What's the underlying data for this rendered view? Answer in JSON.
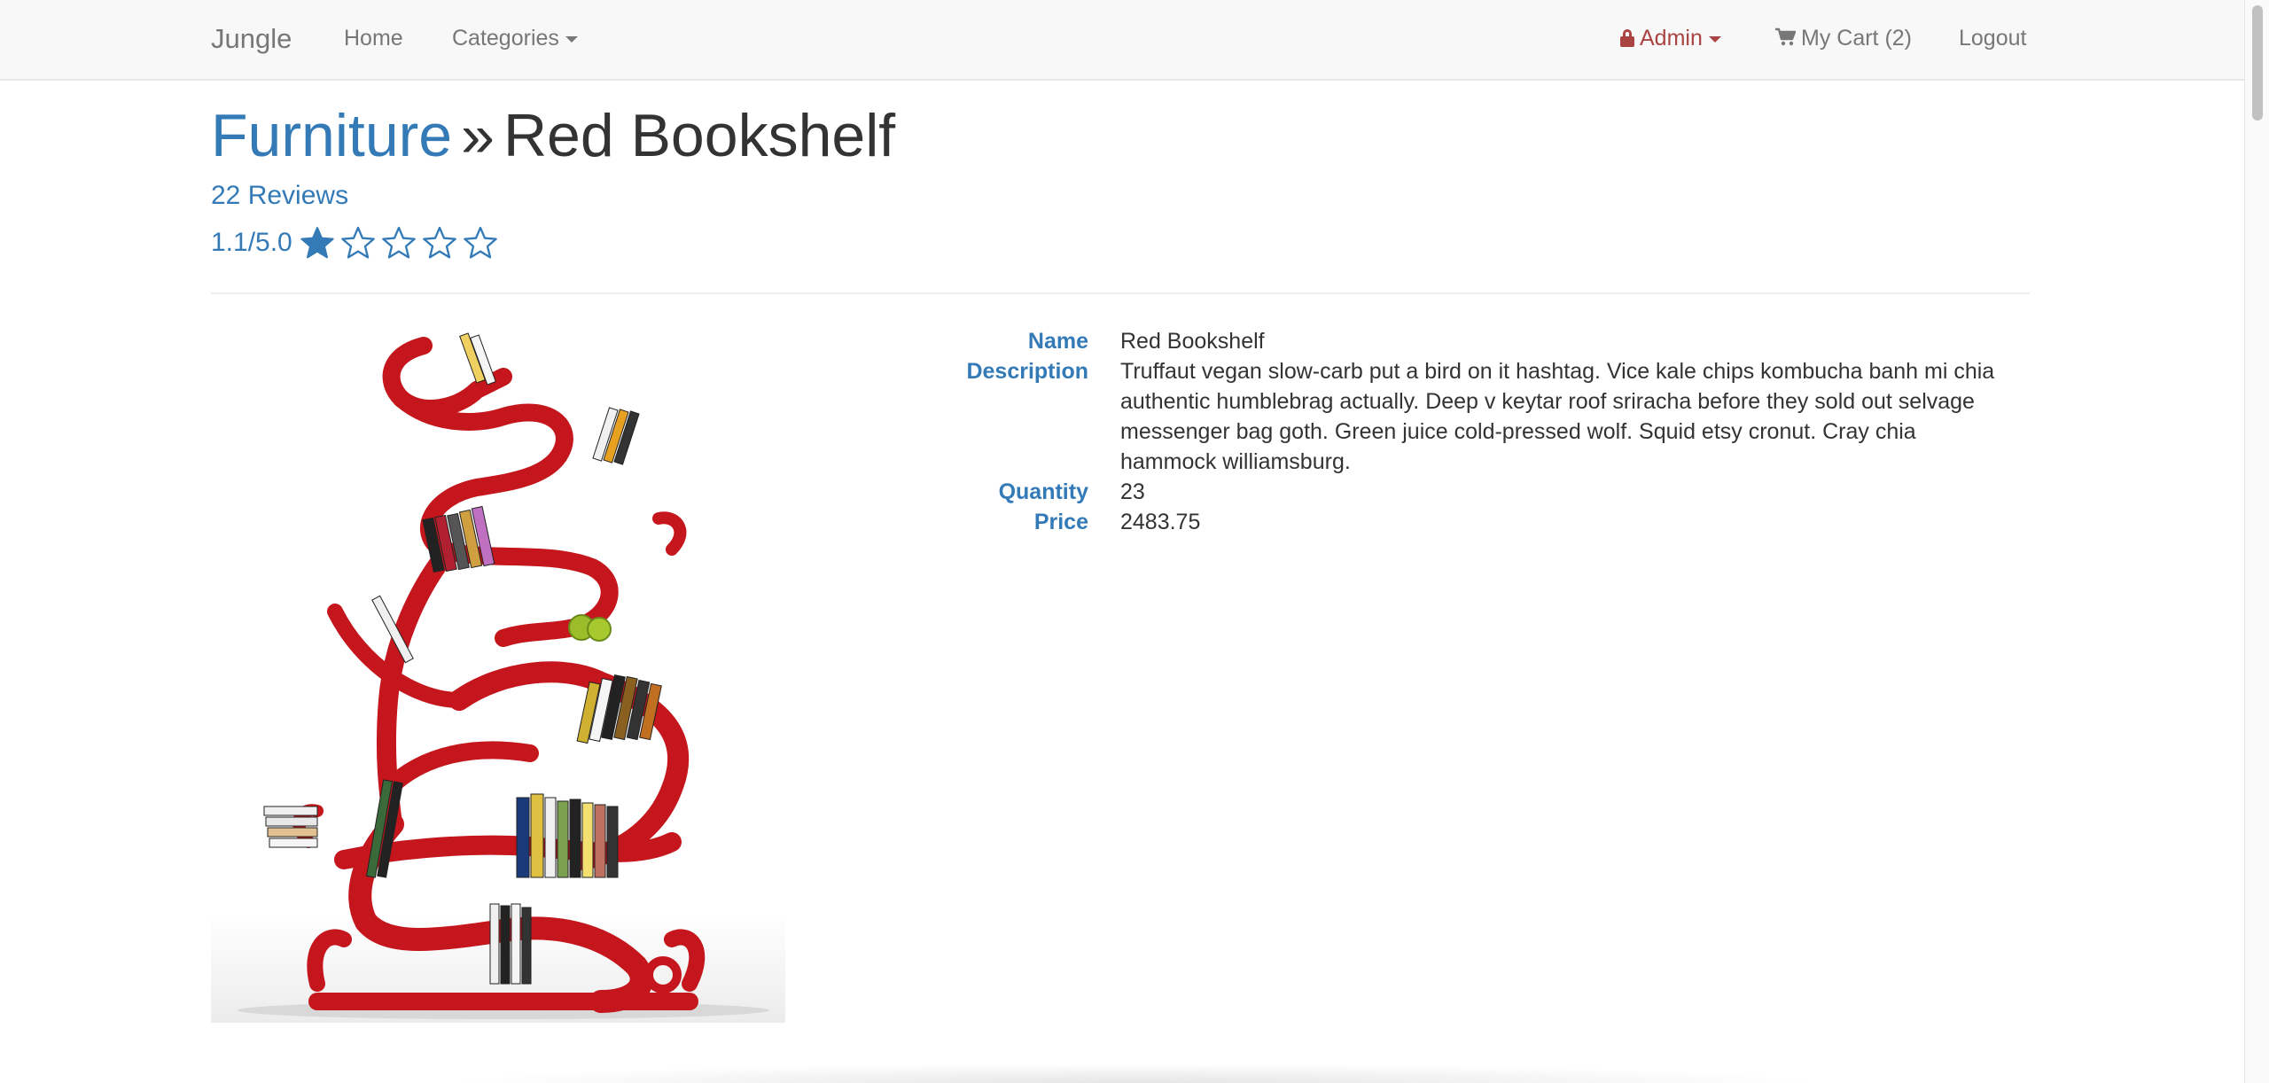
{
  "navbar": {
    "brand": "Jungle",
    "home": "Home",
    "categories": "Categories",
    "admin": "Admin",
    "cart": "My Cart (2)",
    "logout": "Logout",
    "admin_color": "#a94442",
    "link_color": "#777777"
  },
  "header": {
    "category": "Furniture",
    "separator": "»",
    "product_name": "Red Bookshelf",
    "reviews": "22 Reviews",
    "rating_text": "1.1/5.0",
    "rating_value": 1.1,
    "rating_max": 5,
    "accent": "#337ab7"
  },
  "product": {
    "image_icon": "red-bookshelf-photo",
    "fields": [
      {
        "label": "Name",
        "value": "Red Bookshelf"
      },
      {
        "label": "Description",
        "value": "Truffaut vegan slow-carb put a bird on it hashtag. Vice kale chips kombucha banh mi chia authentic humblebrag actually. Deep v keytar roof sriracha before they sold out selvage messenger bag goth. Green juice cold-pressed wolf. Squid etsy cronut. Cray chia hammock williamsburg."
      },
      {
        "label": "Quantity",
        "value": "23"
      },
      {
        "label": "Price",
        "value": "2483.75"
      }
    ]
  }
}
